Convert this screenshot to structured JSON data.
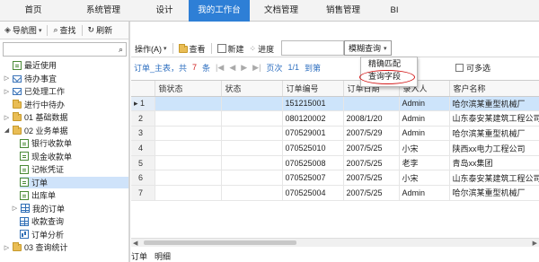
{
  "topnav": {
    "tabs": [
      "首页",
      "系统管理",
      "设计",
      "我的工作台",
      "文档管理",
      "销售管理",
      "BI"
    ],
    "active_index": 3
  },
  "left_toolbar": {
    "nav_label": "导航图",
    "find_label": "查找",
    "refresh_label": "刷新"
  },
  "search": {
    "value": ""
  },
  "tree": [
    {
      "label": "最近使用",
      "icon": "doc-icon"
    },
    {
      "label": "待办事宜",
      "icon": "mail-icon"
    },
    {
      "label": "已处理工作",
      "icon": "mail-icon"
    },
    {
      "label": "进行中待办",
      "icon": "folder-icon"
    },
    {
      "label": "01 基础数据",
      "icon": "folder-icon"
    },
    {
      "label": "02 业务单据",
      "icon": "folder-icon"
    },
    {
      "label": "银行收款单",
      "icon": "doc-icon"
    },
    {
      "label": "现金收款单",
      "icon": "doc-icon"
    },
    {
      "label": "记帐凭证",
      "icon": "doc-icon"
    },
    {
      "label": "订单",
      "icon": "doc-icon"
    },
    {
      "label": "出库单",
      "icon": "doc-icon"
    },
    {
      "label": "我的订单",
      "icon": "grid-icon"
    },
    {
      "label": "收款查询",
      "icon": "grid-icon"
    },
    {
      "label": "订单分析",
      "icon": "chart-icon"
    },
    {
      "label": "03 查询统计",
      "icon": "folder-icon"
    }
  ],
  "main_toolbar": {
    "operate_label": "操作(A)",
    "view_label": "查看",
    "new_label": "新建",
    "progress_label": "进度",
    "dropdown_label": "模糊查询"
  },
  "dropdown_menu": {
    "options": [
      "精确匹配",
      "查询字段"
    ]
  },
  "pager": {
    "title": "订单_主表，共",
    "count": "7",
    "unit": "条",
    "page_label": "页次",
    "page_value": "1/1",
    "goto_label": "到第"
  },
  "multi_select_label": "可多选",
  "table": {
    "columns": [
      "",
      "锁状态",
      "状态",
      "订单编号",
      "订单日期",
      "录入人",
      "客户名称"
    ],
    "rows": [
      [
        "1",
        "",
        "",
        "151215001",
        "",
        "Admin",
        "哈尔滨某重型机械厂"
      ],
      [
        "2",
        "",
        "",
        "080120002",
        "2008/1/20",
        "Admin",
        "山东泰安某建筑工程公司"
      ],
      [
        "3",
        "",
        "",
        "070529001",
        "2007/5/29",
        "Admin",
        "哈尔滨某重型机械厂"
      ],
      [
        "4",
        "",
        "",
        "070525010",
        "2007/5/25",
        "小宋",
        "陕西xx电力工程公司"
      ],
      [
        "5",
        "",
        "",
        "070525008",
        "2007/5/25",
        "老李",
        "青岛xx集团"
      ],
      [
        "6",
        "",
        "",
        "070525007",
        "2007/5/25",
        "小宋",
        "山东泰安某建筑工程公司"
      ],
      [
        "7",
        "",
        "",
        "070525004",
        "2007/5/25",
        "Admin",
        "哈尔滨某重型机械厂"
      ]
    ],
    "selected_row": 0
  },
  "bottom_tabs": [
    "订单",
    "明细"
  ],
  "colors": {
    "accent": "#2e7fd6",
    "highlight_ring": "#d31a1a"
  }
}
